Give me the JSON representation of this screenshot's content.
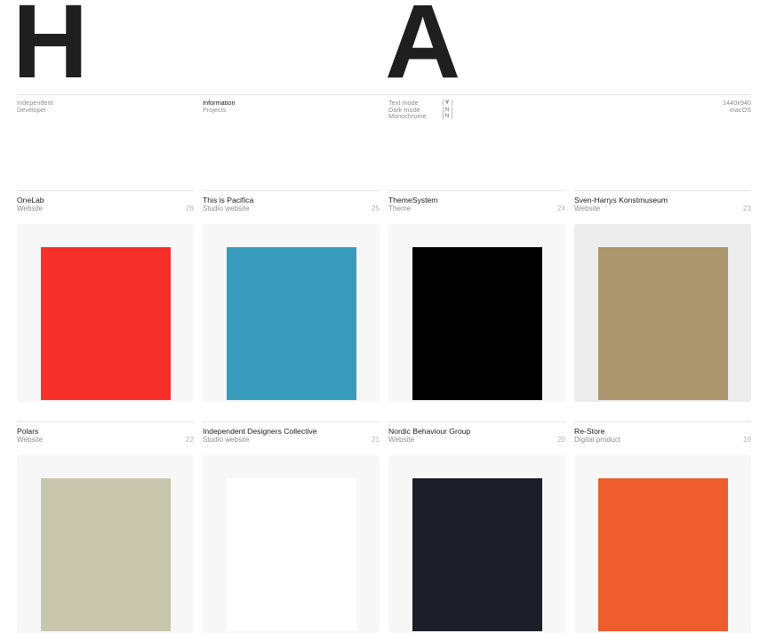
{
  "header": {
    "left_letter": "H",
    "center_letter": "A"
  },
  "meta": {
    "col1": {
      "line1": "Independent",
      "line2": "Developer"
    },
    "col2": {
      "line1": "Information",
      "line2": "Projects"
    },
    "toggles": [
      {
        "label": "Text mode",
        "value": "Y",
        "active": true
      },
      {
        "label": "Dark mode",
        "value": "N",
        "active": false
      },
      {
        "label": "Monochrome",
        "value": "N",
        "active": false
      }
    ],
    "col4": {
      "line1": "1440x940",
      "line2": "macOS"
    }
  },
  "projects": [
    {
      "title": "OneLab",
      "type": "Website",
      "number": "26",
      "swatch": "#f72f2b",
      "bg": "#f7f7f7"
    },
    {
      "title": "This is Pacifica",
      "type": "Studio website",
      "number": "25",
      "swatch": "#3a9cbc",
      "bg": "#f7f7f7"
    },
    {
      "title": "ThemeSystem",
      "type": "Theme",
      "number": "24",
      "swatch": "#000000",
      "bg": "#f7f7f7"
    },
    {
      "title": "Sven-Harrys Konstmuseum",
      "type": "Website",
      "number": "23",
      "swatch": "#ab966d",
      "bg": "#ececec"
    },
    {
      "title": "Polars",
      "type": "Website",
      "number": "22",
      "swatch": "#c8c7ae",
      "bg": "#f7f7f7"
    },
    {
      "title": "Independent Designers Collective",
      "type": "Studio website",
      "number": "21",
      "swatch": "#ffffff",
      "bg": "#f7f7f7"
    },
    {
      "title": "Nordic Behaviour Group",
      "type": "Website",
      "number": "20",
      "swatch": "#1c1e28",
      "bg": "#f7f7f7"
    },
    {
      "title": "Re-Store",
      "type": "Digital product",
      "number": "19",
      "swatch": "#ee5d2d",
      "bg": "#f7f7f7"
    }
  ]
}
